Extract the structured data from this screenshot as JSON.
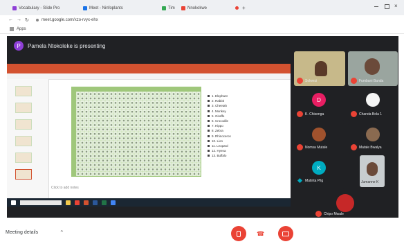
{
  "browser": {
    "tabs": [
      {
        "label": "Vocabulary - Slide Pro",
        "color": "#8e3fd6"
      },
      {
        "label": "Meet - Ninfoplants",
        "color": "#1a73e8"
      },
      {
        "label": "Tim",
        "color": "#34a853"
      },
      {
        "label": "Nnokokwe",
        "color": "#ea4335"
      }
    ],
    "new_tab": "+",
    "address": "meet.google.com/xzo-rvyx-ehx",
    "bookmark": "Apps"
  },
  "meet": {
    "presenting_initial": "P",
    "presenting_text": "Pamela Ntokoleke is presenting",
    "participants": [
      {
        "name": "Solwezi",
        "initial": "",
        "color": "#d9a520"
      },
      {
        "name": "Fumbani Banda",
        "initial": "",
        "color": "#6b4a3a"
      },
      {
        "name": "K. Chisenga",
        "initial": "D",
        "color": "#e91e63"
      },
      {
        "name": "Chanda Bola 1",
        "initial": "",
        "color": "#e8eaed"
      },
      {
        "name": "Nomsa Mutale",
        "initial": "",
        "color": "#a0522d"
      },
      {
        "name": "Matale Bwalya",
        "initial": "",
        "color": "#8a6a50"
      },
      {
        "name": "Mutinta Pilg",
        "initial": "K",
        "color": "#00acc1"
      },
      {
        "name": "Jumanne K",
        "initial": "",
        "color": "#6b4a3a"
      },
      {
        "name": "Chipo Mwale",
        "initial": "",
        "color": "#c62828"
      }
    ],
    "meeting_details": "Meeting details",
    "controls": {
      "mic": "mic-off",
      "hangup": "end-call",
      "camera": "video-off"
    }
  },
  "slide": {
    "legend": [
      "1. Elephant",
      "2. Rabbit",
      "3. Cheetah",
      "4. Monkey",
      "5. Giraffe",
      "6. Crocodile",
      "7. Hippo",
      "8. Zebra",
      "9. Rhinoceros",
      "10. Lion",
      "11. Leopard",
      "12. Hyena",
      "13. Buffalo"
    ],
    "status": "Click to add notes"
  }
}
